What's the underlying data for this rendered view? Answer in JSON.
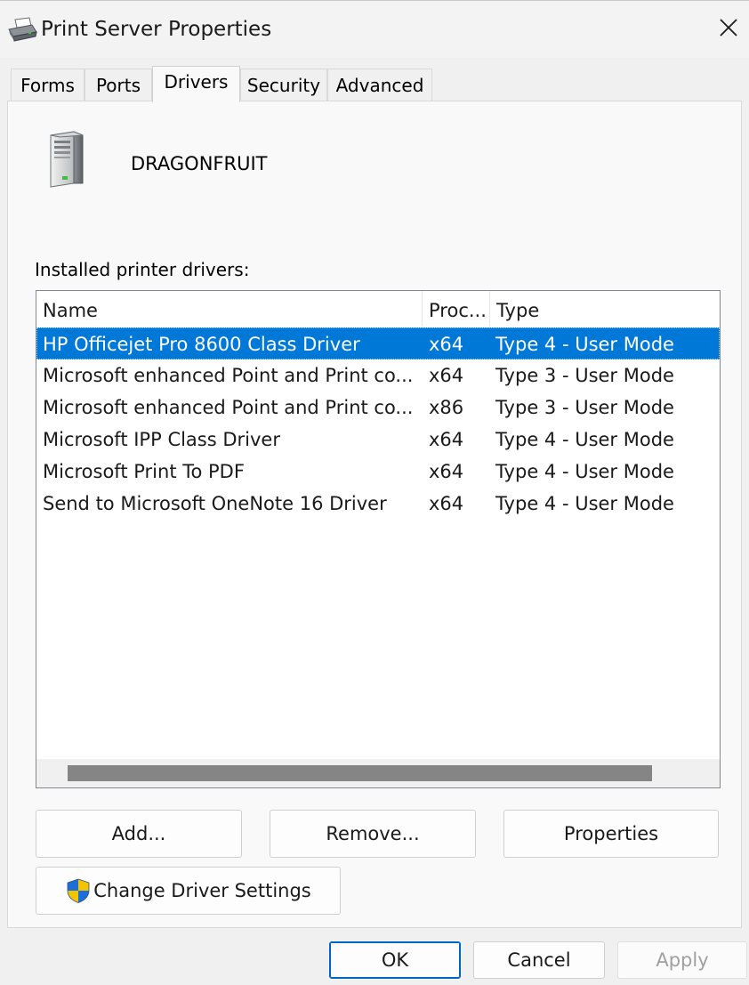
{
  "window": {
    "title": "Print Server Properties",
    "title_icon": "printer-icon",
    "close_icon": "close-icon"
  },
  "tabs": [
    {
      "label": "Forms"
    },
    {
      "label": "Ports"
    },
    {
      "label": "Drivers",
      "active": true
    },
    {
      "label": "Security"
    },
    {
      "label": "Advanced"
    }
  ],
  "server": {
    "icon": "server-tower-icon",
    "name": "DRAGONFRUIT"
  },
  "drivers": {
    "label": "Installed printer drivers:",
    "columns": [
      "Name",
      "Proc...",
      "Type"
    ],
    "rows": [
      {
        "name": "HP Officejet Pro 8600 Class Driver",
        "proc": "x64",
        "type": "Type 4 - User Mode",
        "selected": true
      },
      {
        "name": "Microsoft enhanced Point and Print co...",
        "proc": "x64",
        "type": "Type 3 - User Mode"
      },
      {
        "name": "Microsoft enhanced Point and Print co...",
        "proc": "x86",
        "type": "Type 3 - User Mode"
      },
      {
        "name": "Microsoft IPP Class Driver",
        "proc": "x64",
        "type": "Type 4 - User Mode"
      },
      {
        "name": "Microsoft Print To PDF",
        "proc": "x64",
        "type": "Type 4 - User Mode"
      },
      {
        "name": "Send to Microsoft OneNote 16 Driver",
        "proc": "x64",
        "type": "Type 4 - User Mode"
      }
    ]
  },
  "buttons": {
    "add": "Add...",
    "remove": "Remove...",
    "properties": "Properties",
    "change_driver_settings": "Change Driver Settings",
    "ok": "OK",
    "cancel": "Cancel",
    "apply": "Apply"
  },
  "colors": {
    "selection": "#0078d7",
    "accent_border": "#0067c0",
    "shield_blue": "#1e6ed8",
    "shield_yellow": "#f5c400"
  }
}
